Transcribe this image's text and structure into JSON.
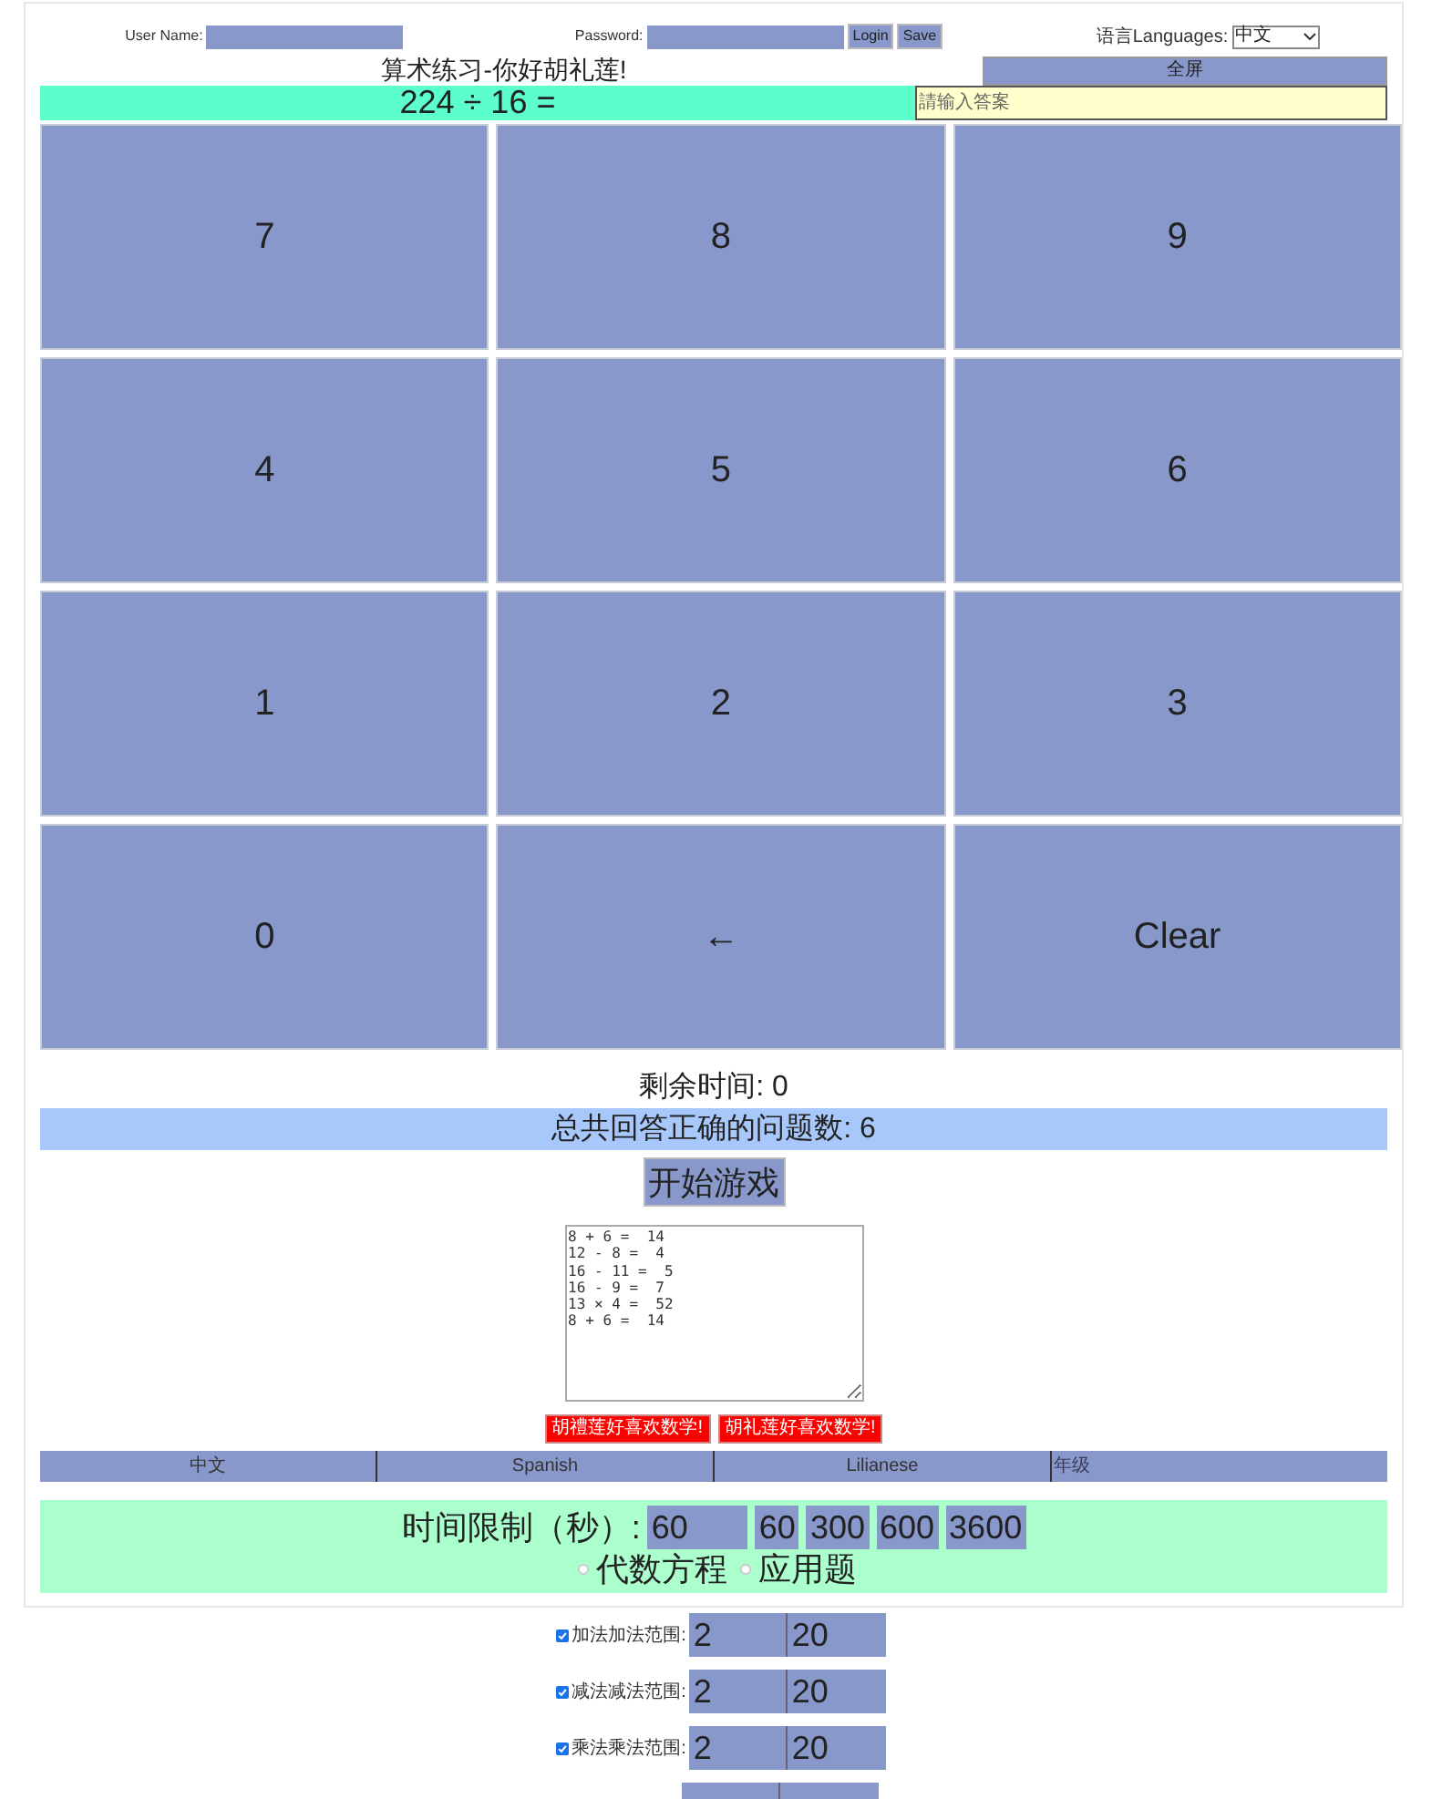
{
  "login": {
    "username_label": "User Name:",
    "password_label": "Password:",
    "buttons": [
      "Login",
      "Save"
    ]
  },
  "language": {
    "label": "语言Languages:",
    "value": "中文"
  },
  "title": "算术练习-你好胡礼莲!",
  "fullscreen_button": "全屏",
  "problem": {
    "text": "224 ÷ 16 =",
    "answer_placeholder": "請输入答案"
  },
  "keypad": [
    "7",
    "8",
    "9",
    "4",
    "5",
    "6",
    "1",
    "2",
    "3",
    "0",
    "←",
    "Clear"
  ],
  "timer": "剩余时间: 0",
  "score": "总共回答正确的问题数: 6",
  "start_button": "开始游戏",
  "history": [
    "8 + 6 =  14",
    "12 - 8 =  4",
    "16 - 11 =  5",
    "16 - 9 =  7",
    "13 × 4 =  52",
    "8 + 6 =  14"
  ],
  "cheer_buttons": [
    "胡禮莲好喜欢数学!",
    "胡礼莲好喜欢数学!"
  ],
  "tabs": [
    {
      "label": "中文"
    },
    {
      "label": "Spanish"
    },
    {
      "label": "Lilianese"
    }
  ],
  "grade_field": {
    "placeholder": "年级"
  },
  "time_limit": {
    "label": "时间限制（秒）:",
    "value": "60",
    "presets": [
      "60",
      "300",
      "600",
      "3600"
    ]
  },
  "question_types": [
    {
      "label": "代数方程",
      "selected": false
    },
    {
      "label": "应用题",
      "selected": false
    }
  ],
  "ranges": [
    {
      "label": "加法加法范围:",
      "checked": true,
      "min": "2",
      "max": "20"
    },
    {
      "label": "减法减法范围:",
      "checked": true,
      "min": "2",
      "max": "20"
    },
    {
      "label": "乘法乘法范围:",
      "checked": true,
      "min": "2",
      "max": "20"
    }
  ]
}
